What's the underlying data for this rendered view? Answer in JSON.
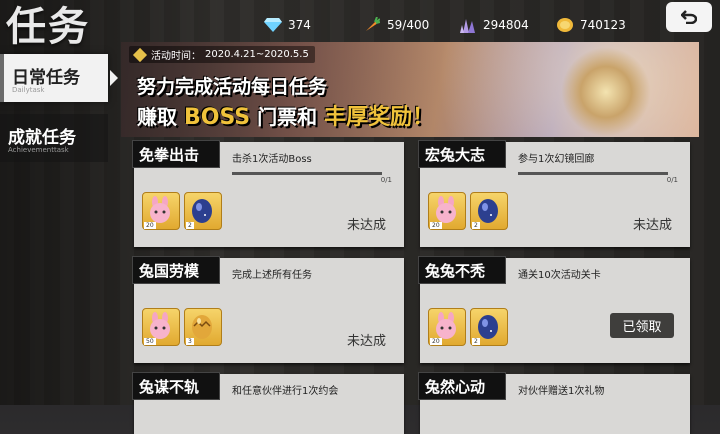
{
  "header": {
    "title": "任务",
    "resources": [
      {
        "icon": "diamond-icon",
        "value": "374"
      },
      {
        "icon": "carrot-icon",
        "value": "59/400"
      },
      {
        "icon": "crystal-icon",
        "value": "294804"
      },
      {
        "icon": "coin-icon",
        "value": "740123"
      }
    ],
    "back_icon": "back-arrow-icon"
  },
  "sidebar": {
    "tabs": [
      {
        "label": "日常任务",
        "sub": "Dailytask",
        "active": true
      },
      {
        "label": "成就任务",
        "sub": "Achievementtask",
        "active": false
      }
    ]
  },
  "banner": {
    "time_label": "活动时间：",
    "time_range": "2020.4.21~2020.5.5",
    "line1": "努力完成活动每日任务",
    "line2_prefix": "赚取",
    "line2_boss": "BOSS",
    "line2_mid": "门票和",
    "line2_reward": "丰厚奖励",
    "line2_suffix": "！"
  },
  "tasks": [
    {
      "title": "免拳出击",
      "desc": "击杀1次活动Boss",
      "progress_text": "0/1",
      "progress": 0,
      "items": [
        {
          "icon": "bunny-mask-icon",
          "qty": "20"
        },
        {
          "icon": "blue-egg-icon",
          "qty": "2"
        }
      ],
      "status": "未达成"
    },
    {
      "title": "宏兔大志",
      "desc": "参与1次幻镜回廊",
      "progress_text": "0/1",
      "progress": 0,
      "items": [
        {
          "icon": "bunny-mask-icon",
          "qty": "20"
        },
        {
          "icon": "blue-egg-icon",
          "qty": "2"
        }
      ],
      "status": "未达成"
    },
    {
      "title": "兔国劳模",
      "desc": "完成上述所有任务",
      "items": [
        {
          "icon": "bunny-mask-icon",
          "qty": "50"
        },
        {
          "icon": "gold-egg-icon",
          "qty": "3"
        }
      ],
      "status": "未达成"
    },
    {
      "title": "兔兔不秃",
      "desc": "通关10次活动关卡",
      "items": [
        {
          "icon": "bunny-mask-icon",
          "qty": "20"
        },
        {
          "icon": "blue-egg-icon",
          "qty": "2"
        }
      ],
      "claimed_label": "已领取"
    },
    {
      "title": "兔谋不轨",
      "desc": "和任意伙伴进行1次约会"
    },
    {
      "title": "兔然心动",
      "desc": "对伙伴赠送1次礼物"
    }
  ],
  "colors": {
    "accent": "#f0c23b",
    "card_bg": "#d9d8d6",
    "title_bg": "#111111"
  }
}
